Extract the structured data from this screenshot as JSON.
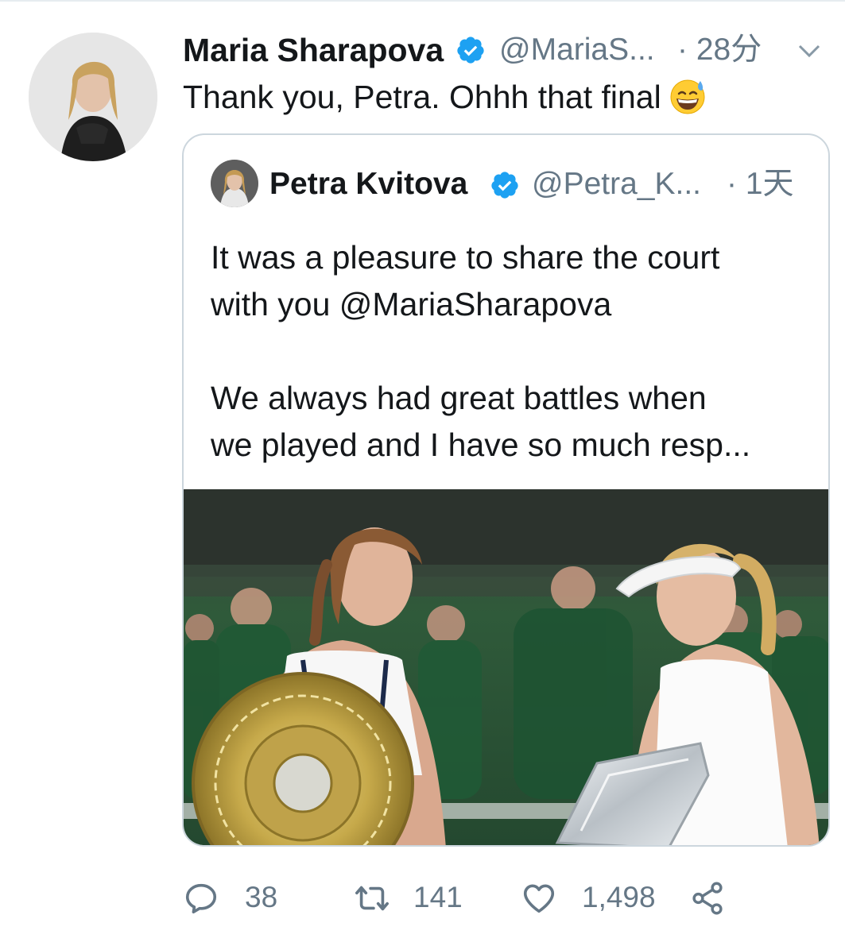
{
  "tweet": {
    "author_name": "Maria Sharapova",
    "author_handle": "@MariaS...",
    "time": "· 28分",
    "text": "Thank you, Petra. Ohhh that final",
    "emoji": "grinning-sweat-emoji"
  },
  "quoted_tweet": {
    "author_name": "Petra Kvitova",
    "author_handle": "@Petra_K...",
    "time": "· 1天",
    "text_lines": [
      "It was a pleasure to share the court",
      "with you @MariaSharapova",
      "We always had great battles when",
      "we played and I have so much resp..."
    ]
  },
  "actions": {
    "replies": "38",
    "retweets": "141",
    "likes": "1,498"
  },
  "colors": {
    "verified": "#1da1f2",
    "secondary_text": "#657786",
    "border": "#ccd6dd"
  }
}
